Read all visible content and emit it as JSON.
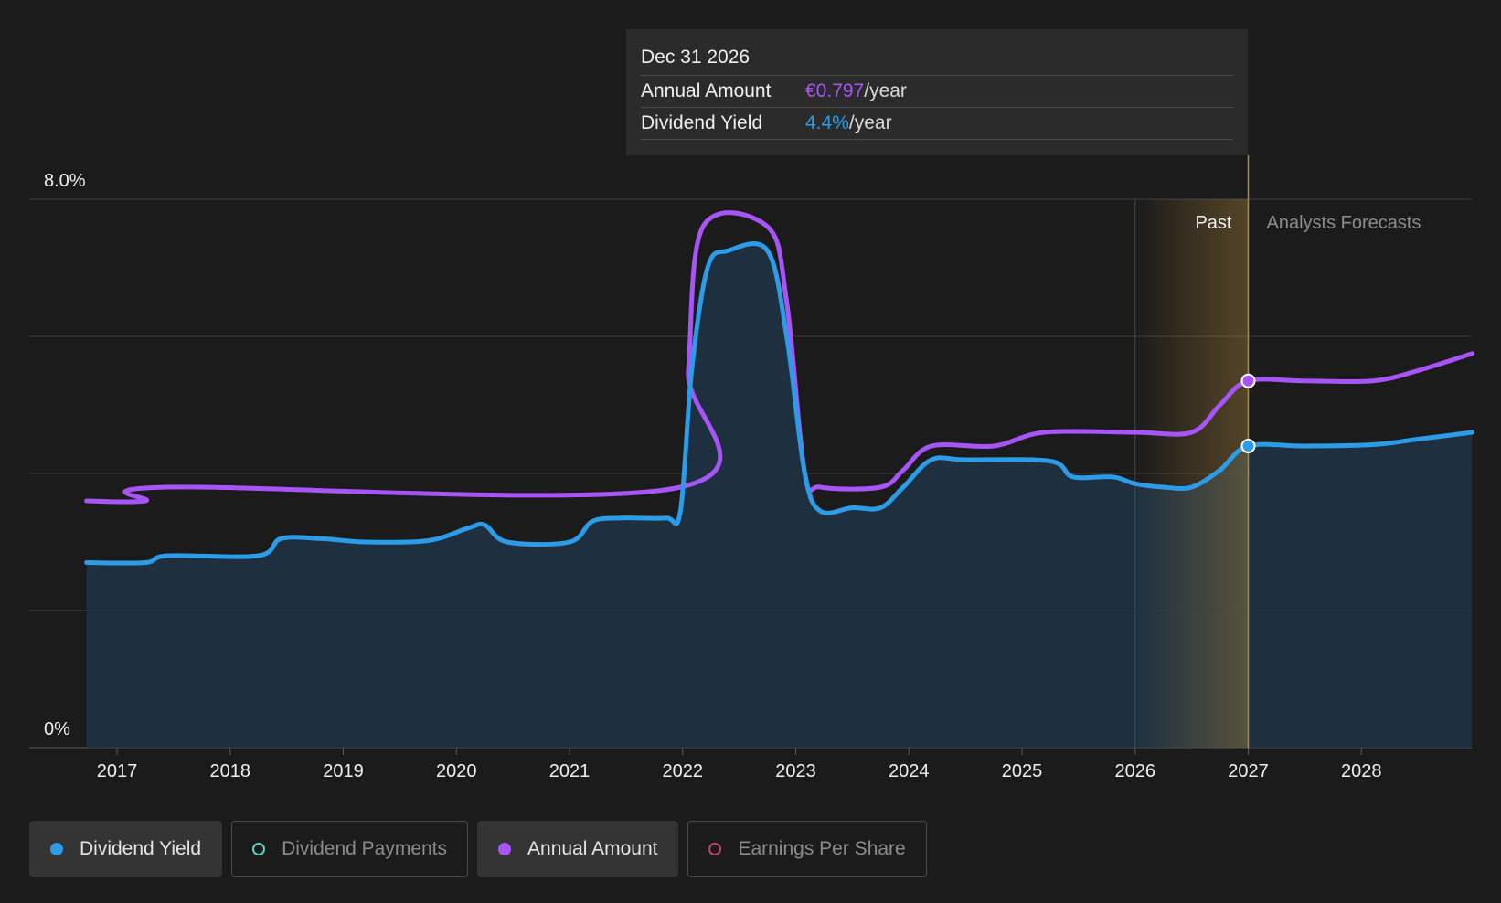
{
  "tooltip": {
    "date": "Dec 31 2026",
    "annual_label": "Annual Amount",
    "annual_value": "€0.797",
    "yield_label": "Dividend Yield",
    "yield_value": "4.4%",
    "unit": "/year"
  },
  "regions": {
    "past_label": "Past",
    "forecast_label": "Analysts Forecasts"
  },
  "legend": [
    {
      "label": "Dividend Yield",
      "color": "#2d9ce8",
      "active": true
    },
    {
      "label": "Dividend Payments",
      "color": "#5fd3c4",
      "active": false
    },
    {
      "label": "Annual Amount",
      "color": "#a855f7",
      "active": true
    },
    {
      "label": "Earnings Per Share",
      "color": "#c2447e",
      "active": false
    }
  ],
  "colors": {
    "background": "#1b1b1b",
    "dividend_yield": "#2d9ce8",
    "annual_amount": "#a855f7",
    "grid": "#3d3d3d",
    "forecast_band": "#b38a3a"
  },
  "chart_data": {
    "type": "line",
    "y_axis": {
      "min": 0,
      "max": 8,
      "unit": "%",
      "tick_labels": [
        "0%",
        "8.0%"
      ],
      "gridlines": [
        0,
        2,
        4,
        6,
        8
      ]
    },
    "x_axis": {
      "tick_labels": [
        "2017",
        "2018",
        "2019",
        "2020",
        "2021",
        "2022",
        "2023",
        "2024",
        "2025",
        "2026",
        "2027",
        "2028"
      ]
    },
    "past_forecast_boundary": 2027.0,
    "highlight_band": [
      2026.0,
      2027.0
    ],
    "selected_x": 2027.0,
    "series": [
      {
        "name": "Dividend Yield",
        "points": [
          [
            2016.73,
            2.7
          ],
          [
            2017.25,
            2.7
          ],
          [
            2017.45,
            2.8
          ],
          [
            2018.25,
            2.8
          ],
          [
            2018.45,
            3.05
          ],
          [
            2018.8,
            3.05
          ],
          [
            2019.2,
            3.0
          ],
          [
            2019.75,
            3.02
          ],
          [
            2020.1,
            3.2
          ],
          [
            2020.25,
            3.25
          ],
          [
            2020.45,
            3.0
          ],
          [
            2021.0,
            3.0
          ],
          [
            2021.2,
            3.3
          ],
          [
            2021.45,
            3.35
          ],
          [
            2021.85,
            3.35
          ],
          [
            2021.98,
            3.45
          ],
          [
            2022.08,
            5.5
          ],
          [
            2022.22,
            7.0
          ],
          [
            2022.4,
            7.25
          ],
          [
            2022.75,
            7.25
          ],
          [
            2022.92,
            6.0
          ],
          [
            2023.08,
            4.0
          ],
          [
            2023.22,
            3.45
          ],
          [
            2023.5,
            3.5
          ],
          [
            2023.75,
            3.5
          ],
          [
            2023.95,
            3.8
          ],
          [
            2024.2,
            4.2
          ],
          [
            2024.5,
            4.2
          ],
          [
            2025.25,
            4.18
          ],
          [
            2025.45,
            3.95
          ],
          [
            2025.8,
            3.95
          ],
          [
            2026.0,
            3.85
          ],
          [
            2026.25,
            3.8
          ],
          [
            2026.5,
            3.8
          ],
          [
            2026.75,
            4.05
          ],
          [
            2027.0,
            4.4
          ],
          [
            2027.5,
            4.4
          ],
          [
            2028.1,
            4.42
          ],
          [
            2028.5,
            4.5
          ],
          [
            2028.98,
            4.6
          ]
        ]
      },
      {
        "name": "Annual Amount",
        "points": [
          [
            2016.73,
            3.6
          ],
          [
            2017.25,
            3.6
          ],
          [
            2017.45,
            3.8
          ],
          [
            2021.98,
            3.8
          ],
          [
            2022.05,
            5.5
          ],
          [
            2022.18,
            7.6
          ],
          [
            2022.75,
            7.6
          ],
          [
            2022.92,
            6.5
          ],
          [
            2023.08,
            4.0
          ],
          [
            2023.22,
            3.8
          ],
          [
            2023.75,
            3.8
          ],
          [
            2023.95,
            4.05
          ],
          [
            2024.2,
            4.4
          ],
          [
            2024.75,
            4.4
          ],
          [
            2025.2,
            4.6
          ],
          [
            2026.0,
            4.6
          ],
          [
            2026.5,
            4.6
          ],
          [
            2026.75,
            5.0
          ],
          [
            2027.0,
            5.35
          ],
          [
            2027.5,
            5.35
          ],
          [
            2028.1,
            5.35
          ],
          [
            2028.5,
            5.5
          ],
          [
            2028.98,
            5.75
          ]
        ]
      }
    ]
  }
}
